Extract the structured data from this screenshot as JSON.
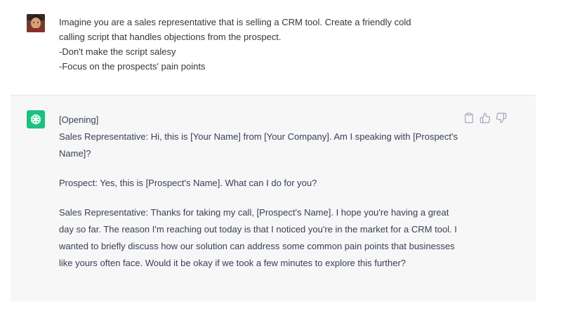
{
  "user_message": {
    "lines": [
      "Imagine you are a sales representative that is selling a CRM tool. Create a friendly cold",
      "calling script that handles objections from the prospect.",
      "-Don't make the script salesy",
      "-Focus on the prospects' pain points"
    ]
  },
  "assistant_message": {
    "heading": "[Opening]",
    "p1": "Sales Representative: Hi, this is [Your Name] from [Your Company]. Am I speaking with [Prospect's Name]?",
    "p2": "Prospect: Yes, this is [Prospect's Name]. What can I do for you?",
    "p3": "Sales Representative: Thanks for taking my call, [Prospect's Name]. I hope you're having a great day so far. The reason I'm reaching out today is that I noticed you're in the market for a CRM tool. I wanted to briefly discuss how our solution can address some common pain points that businesses like yours often face. Would it be okay if we took a few minutes to explore this further?"
  },
  "actions": {
    "copy": "copy-icon",
    "thumbs_up": "thumbs-up-icon",
    "thumbs_down": "thumbs-down-icon"
  },
  "colors": {
    "assistant_bg": "#f7f7f8",
    "gpt_logo_bg": "#19c37d",
    "text": "#374151",
    "icon": "#acacbe"
  }
}
